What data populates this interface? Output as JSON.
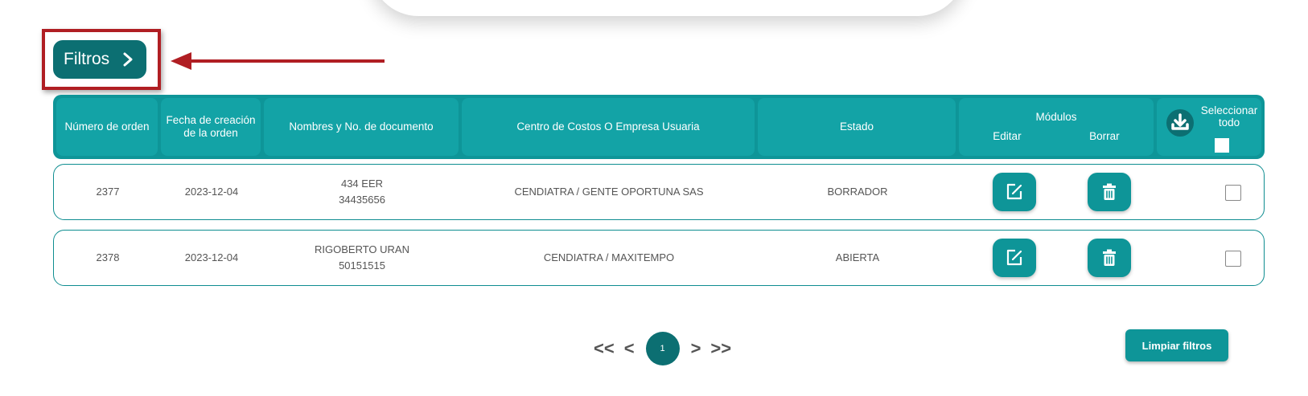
{
  "filters": {
    "label": "Filtros"
  },
  "table": {
    "headers": {
      "order_number": "Número de orden",
      "creation_date": "Fecha de creación de la orden",
      "names_doc": "Nombres y No. de documento",
      "cost_center": "Centro de Costos O Empresa Usuaria",
      "status": "Estado",
      "modules": "Módulos",
      "edit": "Editar",
      "delete": "Borrar",
      "select_all": "Seleccionar todo"
    },
    "rows": [
      {
        "order": "2377",
        "date": "2023-12-04",
        "name": "434 EER",
        "document": "34435656",
        "cost_center": "CENDIATRA / GENTE OPORTUNA SAS",
        "status": "BORRADOR"
      },
      {
        "order": "2378",
        "date": "2023-12-04",
        "name": "RIGOBERTO URAN",
        "document": "50151515",
        "cost_center": "CENDIATRA / MAXITEMPO",
        "status": "ABIERTA"
      }
    ]
  },
  "pagination": {
    "first": "<<",
    "prev": "<",
    "current_page": "1",
    "next": ">",
    "last": ">>"
  },
  "clear_filters": {
    "label": "Limpiar filtros"
  },
  "colors": {
    "primary_dark": "#0c6f72",
    "primary": "#0e9598",
    "highlight_red": "#b01e23"
  }
}
